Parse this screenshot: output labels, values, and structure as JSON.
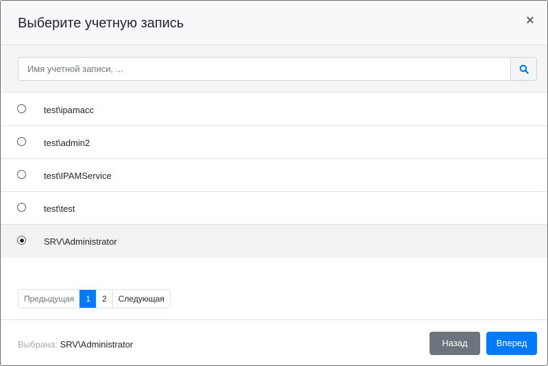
{
  "dialog": {
    "title": "Выберите учетную запись",
    "close": "×"
  },
  "search": {
    "placeholder": "Имя учетной записи, ...",
    "value": ""
  },
  "accounts": [
    {
      "label": "test\\ipamacc",
      "selected": false
    },
    {
      "label": "test\\admin2",
      "selected": false
    },
    {
      "label": "test\\IPAMService",
      "selected": false
    },
    {
      "label": "test\\test",
      "selected": false
    },
    {
      "label": "SRV\\Administrator",
      "selected": true
    }
  ],
  "pagination": {
    "prev": "Предыдущая",
    "pages": [
      "1",
      "2"
    ],
    "current": "1",
    "next": "Следующая"
  },
  "footer": {
    "selected_label": "Выбрана:",
    "selected_value": "SRV\\Administrator",
    "back": "Назад",
    "forward": "Вперед"
  },
  "colors": {
    "primary": "#007bff",
    "secondary": "#6c757d"
  }
}
